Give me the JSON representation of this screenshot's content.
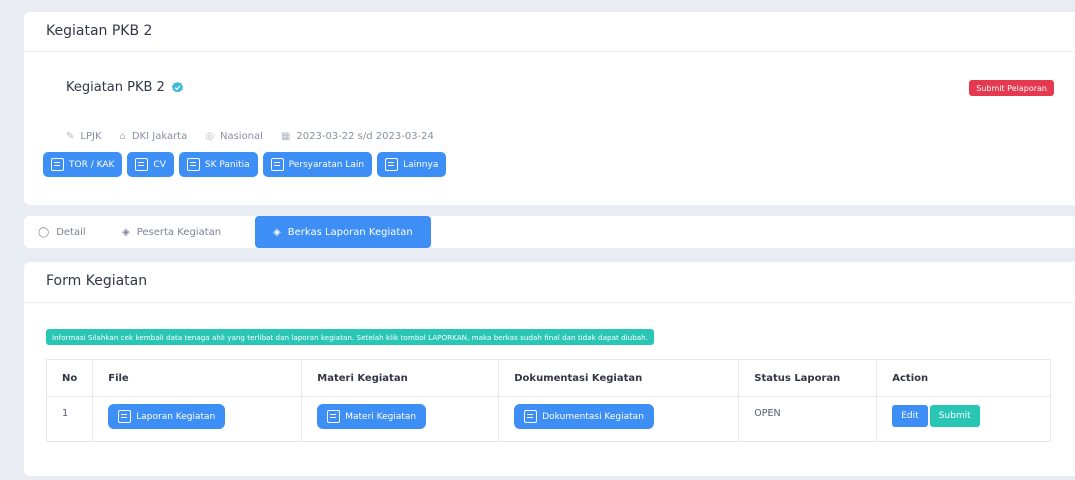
{
  "activity_card": {
    "header_title": "Kegiatan PKB 2",
    "title": "Kegiatan PKB 2",
    "meta": {
      "organizer": "LPJK",
      "location": "DKI Jakarta",
      "scope": "Nasional",
      "date_range": "2023-03-22 s/d 2023-03-24"
    },
    "submit_label": "Submit Pelaporan",
    "doc_buttons": [
      "TOR / KAK",
      "CV",
      "SK Panitia",
      "Persyaratan Lain",
      "Lainnya"
    ]
  },
  "tabs": [
    {
      "label": "Detail",
      "icon": "chat-icon"
    },
    {
      "label": "Peserta Kegiatan",
      "icon": "layers-icon"
    },
    {
      "label": "Berkas Laporan Kegiatan",
      "icon": "layers-icon",
      "active": true
    }
  ],
  "form_card": {
    "title": "Form Kegiatan",
    "info": "Informasi Silahkan cek kembali data tenaga ahli yang terlibat dan laporan kegiatan. Setelah klik tombol LAPORKAN, maka berkas sudah final dan tidak dapat diubah.",
    "columns": [
      "No",
      "File",
      "Materi Kegiatan",
      "Dokumentasi Kegiatan",
      "Status Laporan",
      "Action"
    ],
    "rows": [
      {
        "no": "1",
        "file": "Laporan Kegiatan",
        "materi": "Materi Kegiatan",
        "dokumentasi": "Dokumentasi Kegiatan",
        "status": "OPEN",
        "edit_label": "Edit",
        "submit_label": "Submit"
      }
    ]
  },
  "colors": {
    "primary": "#3d8ef5",
    "danger": "#e5394f",
    "info": "#29c6b5"
  }
}
